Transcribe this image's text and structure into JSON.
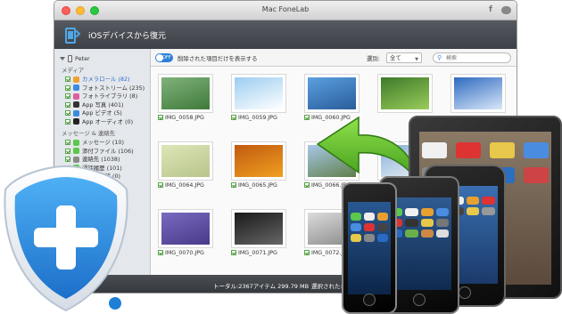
{
  "window": {
    "title": "Mac FoneLab",
    "social_fb": "f"
  },
  "header": {
    "title": "iOSデバイスから復元"
  },
  "sidebar": {
    "device": "Peter",
    "sections": [
      {
        "title": "メディア",
        "items": [
          {
            "label": "カメラロール (82)",
            "color": "#f0a030",
            "selected": true
          },
          {
            "label": "フォトストリーム (235)",
            "color": "#3b8be0"
          },
          {
            "label": "フォトライブラリ (8)",
            "color": "#e05aa0"
          },
          {
            "label": "App 写真 (401)",
            "color": "#333333"
          },
          {
            "label": "App ビデオ (5)",
            "color": "#3b8be0"
          },
          {
            "label": "App オーディオ (0)",
            "color": "#222222"
          }
        ]
      },
      {
        "title": "メッセージ & 連絡先",
        "items": [
          {
            "label": "メッセージ (10)",
            "color": "#5ac84a"
          },
          {
            "label": "添付ファイル (106)",
            "color": "#5ac84a"
          },
          {
            "label": "連絡先 (1038)",
            "color": "#8a8a8a"
          },
          {
            "label": "通話履歴 (101)",
            "color": "#5ac84a"
          },
          {
            "label": "留守番電話 (0)",
            "color": "#333333"
          },
          {
            "label": "(31)",
            "color": "#5ac84a"
          }
        ]
      }
    ]
  },
  "toolbar": {
    "toggle_text": "OFF",
    "toggle_label": "削除された項目だけを表示する",
    "filter_label": "選別:",
    "filter_value": "全て",
    "search_placeholder": "検索"
  },
  "photos": [
    {
      "name": "IMG_0058.JPG",
      "c1": "#7fb27a",
      "c2": "#3f7a3a"
    },
    {
      "name": "IMG_0059.JPG",
      "c1": "#9ccdf0",
      "c2": "#ffffff"
    },
    {
      "name": "IMG_0060.JPG",
      "c1": "#5aa0e0",
      "c2": "#2a5c9a"
    },
    {
      "name": "",
      "c1": "#3d7a2a",
      "c2": "#9acc5a"
    },
    {
      "name": "",
      "c1": "#2f6ac0",
      "c2": "#d8e8f8"
    },
    {
      "name": "IMG_0064.JPG",
      "c1": "#dde6b8",
      "c2": "#b7c48a"
    },
    {
      "name": "IMG_0065.JPG",
      "c1": "#c05a10",
      "c2": "#f0a020"
    },
    {
      "name": "IMG_0066.JPG",
      "c1": "#a8c8e8",
      "c2": "#5f7f4a"
    },
    {
      "name": "",
      "c1": "#88b0d8",
      "c2": "#e8eef4"
    },
    {
      "name": "",
      "c1": "#e8e8e8",
      "c2": "#b0b0b0"
    },
    {
      "name": "IMG_0070.JPG",
      "c1": "#7a6ac0",
      "c2": "#4a3a8a"
    },
    {
      "name": "IMG_0071.JPG",
      "c1": "#1a1a1a",
      "c2": "#666666"
    },
    {
      "name": "IMG_0072.JPG",
      "c1": "#dcdcdc",
      "c2": "#8a8a8a"
    },
    {
      "name": "",
      "c1": "#555555",
      "c2": "#999999"
    },
    {
      "name": "",
      "c1": "#cfd8e0",
      "c2": "#8ea0b0"
    }
  ],
  "status": {
    "total": "トータル:2367アイテム 299.79 MB",
    "selected": "選択された:2367アイテ"
  },
  "colors": {
    "accent": "#2f7fd9",
    "logo_blue": "#2a8be0",
    "arrow_green": "#5dbd2a"
  }
}
